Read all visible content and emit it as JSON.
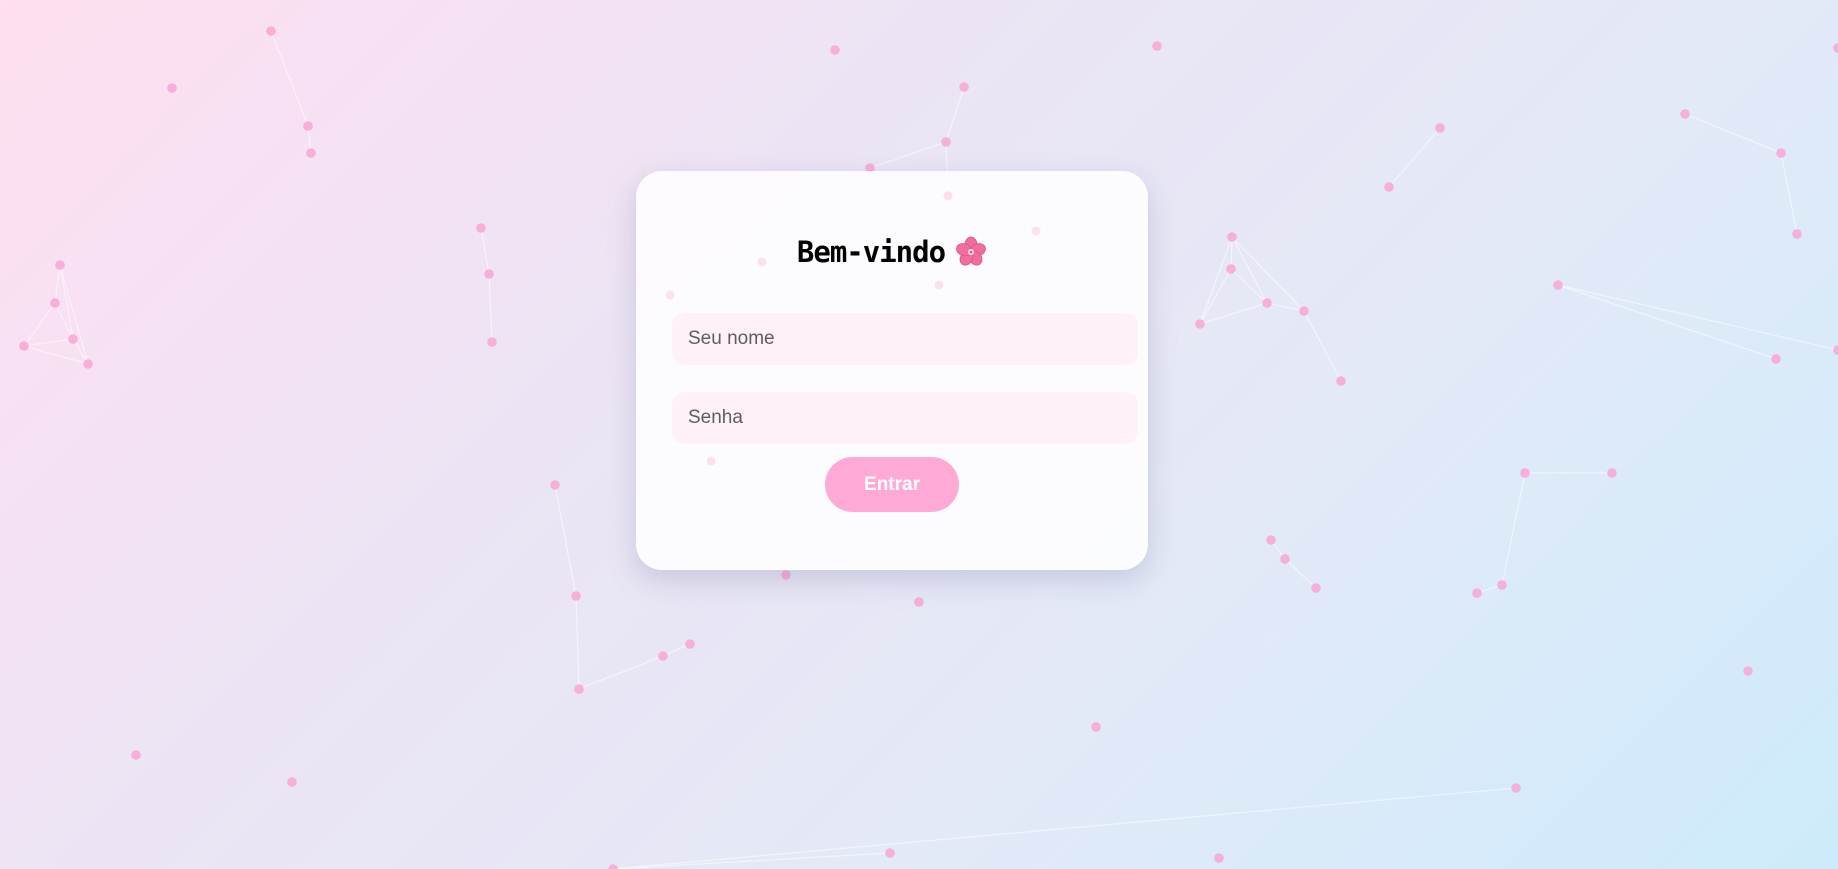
{
  "login": {
    "title": "Bem-vindo",
    "title_icon": "cherry-blossom-icon",
    "name_placeholder": "Seu nome",
    "password_placeholder": "Senha",
    "submit_label": "Entrar"
  },
  "theme": {
    "accent": "#ffaad6",
    "particle": "#f7a8d6",
    "input_background": "#fff0f6"
  }
}
